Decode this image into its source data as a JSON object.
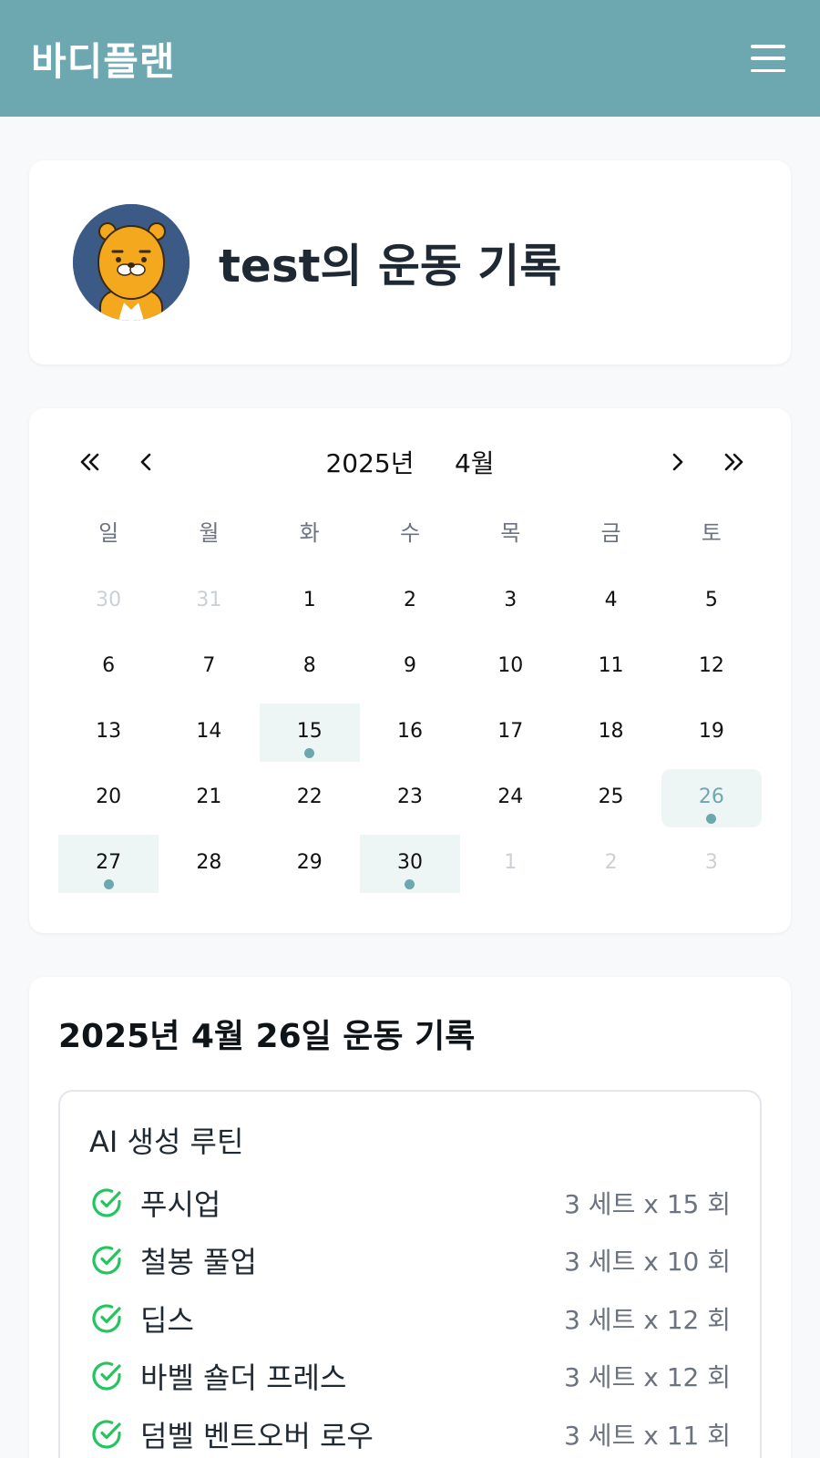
{
  "header": {
    "brand": "바디플랜"
  },
  "profile": {
    "title": "test의 운동 기록"
  },
  "calendar": {
    "year_label": "2025년",
    "month_label": "4월",
    "weekdays": [
      "일",
      "월",
      "화",
      "수",
      "목",
      "금",
      "토"
    ],
    "days": [
      {
        "label": "30",
        "other": true
      },
      {
        "label": "31",
        "other": true
      },
      {
        "label": "1"
      },
      {
        "label": "2"
      },
      {
        "label": "3"
      },
      {
        "label": "4"
      },
      {
        "label": "5"
      },
      {
        "label": "6"
      },
      {
        "label": "7"
      },
      {
        "label": "8"
      },
      {
        "label": "9"
      },
      {
        "label": "10"
      },
      {
        "label": "11"
      },
      {
        "label": "12"
      },
      {
        "label": "13"
      },
      {
        "label": "14"
      },
      {
        "label": "15",
        "record": true
      },
      {
        "label": "16"
      },
      {
        "label": "17"
      },
      {
        "label": "18"
      },
      {
        "label": "19"
      },
      {
        "label": "20"
      },
      {
        "label": "21"
      },
      {
        "label": "22"
      },
      {
        "label": "23"
      },
      {
        "label": "24"
      },
      {
        "label": "25"
      },
      {
        "label": "26",
        "record": true,
        "selected": true
      },
      {
        "label": "27",
        "record": true
      },
      {
        "label": "28"
      },
      {
        "label": "29"
      },
      {
        "label": "30",
        "record": true
      },
      {
        "label": "1",
        "other": true
      },
      {
        "label": "2",
        "other": true
      },
      {
        "label": "3",
        "other": true
      }
    ]
  },
  "record": {
    "title": "2025년 4월 26일 운동 기록",
    "routine_name": "AI 생성 루틴",
    "exercises": [
      {
        "name": "푸시업",
        "detail": "3 세트 x 15 회"
      },
      {
        "name": "철봉 풀업",
        "detail": "3 세트 x 10 회"
      },
      {
        "name": "딥스",
        "detail": "3 세트 x 12 회"
      },
      {
        "name": "바벨 숄더 프레스",
        "detail": "3 세트 x 12 회"
      },
      {
        "name": "덤벨 벤트오버 로우",
        "detail": "3 세트 x 11 회"
      }
    ]
  },
  "colors": {
    "accent": "#6da7b0",
    "check": "#22c55e",
    "record_bg": "#eef6f5"
  }
}
